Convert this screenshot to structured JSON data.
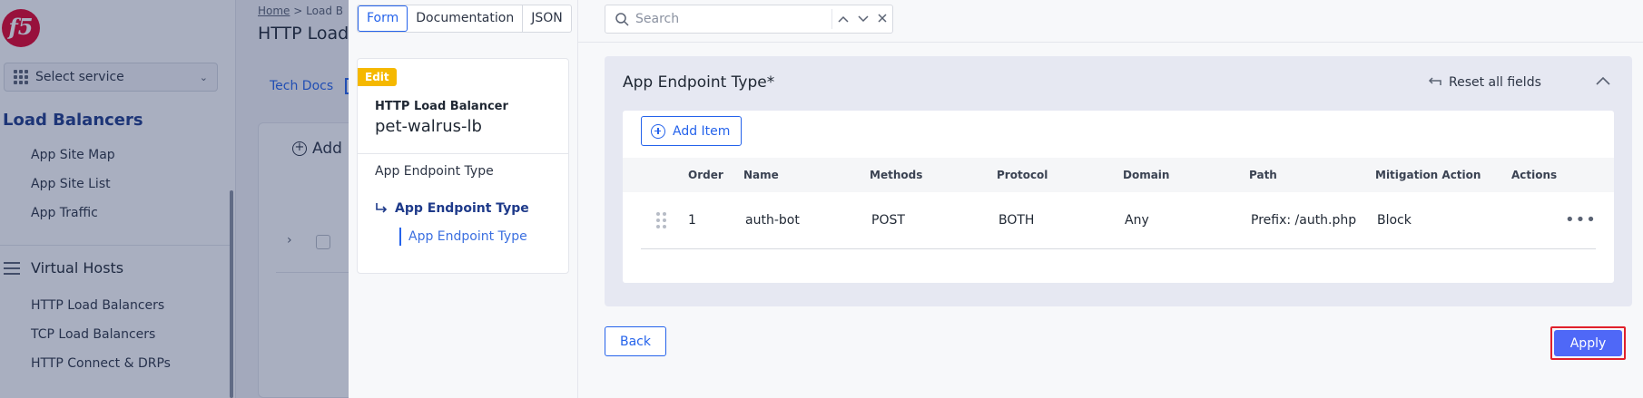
{
  "background": {
    "logo_text": "f5",
    "select_service": "Select service",
    "section_title": "Load Balancers",
    "section_items": [
      "App Site Map",
      "App Site List",
      "App Traffic"
    ],
    "virtual_hosts_title": "Virtual Hosts",
    "virtual_hosts_items": [
      "HTTP Load Balancers",
      "TCP Load Balancers",
      "HTTP Connect & DRPs"
    ],
    "breadcrumb_home": "Home",
    "breadcrumb_sep": ">",
    "breadcrumb_current": "Load B",
    "page_title": "HTTP Load",
    "tech_docs": "Tech Docs",
    "add_label": "Add",
    "overlay_color": "#1e2d5a"
  },
  "modal": {
    "view_tabs": [
      {
        "label": "Form",
        "active": true
      },
      {
        "label": "Documentation",
        "active": false
      },
      {
        "label": "JSON",
        "active": false
      }
    ],
    "nav": {
      "badge": "Edit",
      "object_kind": "HTTP Load Balancer",
      "object_name": "pet-walrus-lb",
      "level1": "App Endpoint Type",
      "level2": "App Endpoint Type",
      "level3": "App Endpoint Type"
    },
    "search": {
      "placeholder": "Search",
      "up_icon": "chevron-up-icon",
      "down_icon": "chevron-down-icon",
      "clear_icon": "close-icon"
    },
    "section": {
      "title": "App Endpoint Type",
      "required_marker": "*",
      "reset_label": "Reset all fields",
      "add_item_label": "Add Item"
    },
    "table": {
      "columns": [
        "Order",
        "Name",
        "Methods",
        "Protocol",
        "Domain",
        "Path",
        "Mitigation Action",
        "Actions"
      ],
      "rows": [
        {
          "order": "1",
          "name": "auth-bot",
          "methods": "POST",
          "protocol": "BOTH",
          "domain": "Any",
          "path": "Prefix: /auth.php",
          "mitigation": "Block",
          "actions": "•••"
        }
      ]
    },
    "footer": {
      "back_label": "Back",
      "apply_label": "Apply"
    },
    "colors": {
      "accent": "#2563eb",
      "apply_bg": "#4f68f7",
      "highlight": "#e0202a",
      "edit_badge": "#f5b800",
      "panel_bg": "#e6e8f2"
    }
  }
}
